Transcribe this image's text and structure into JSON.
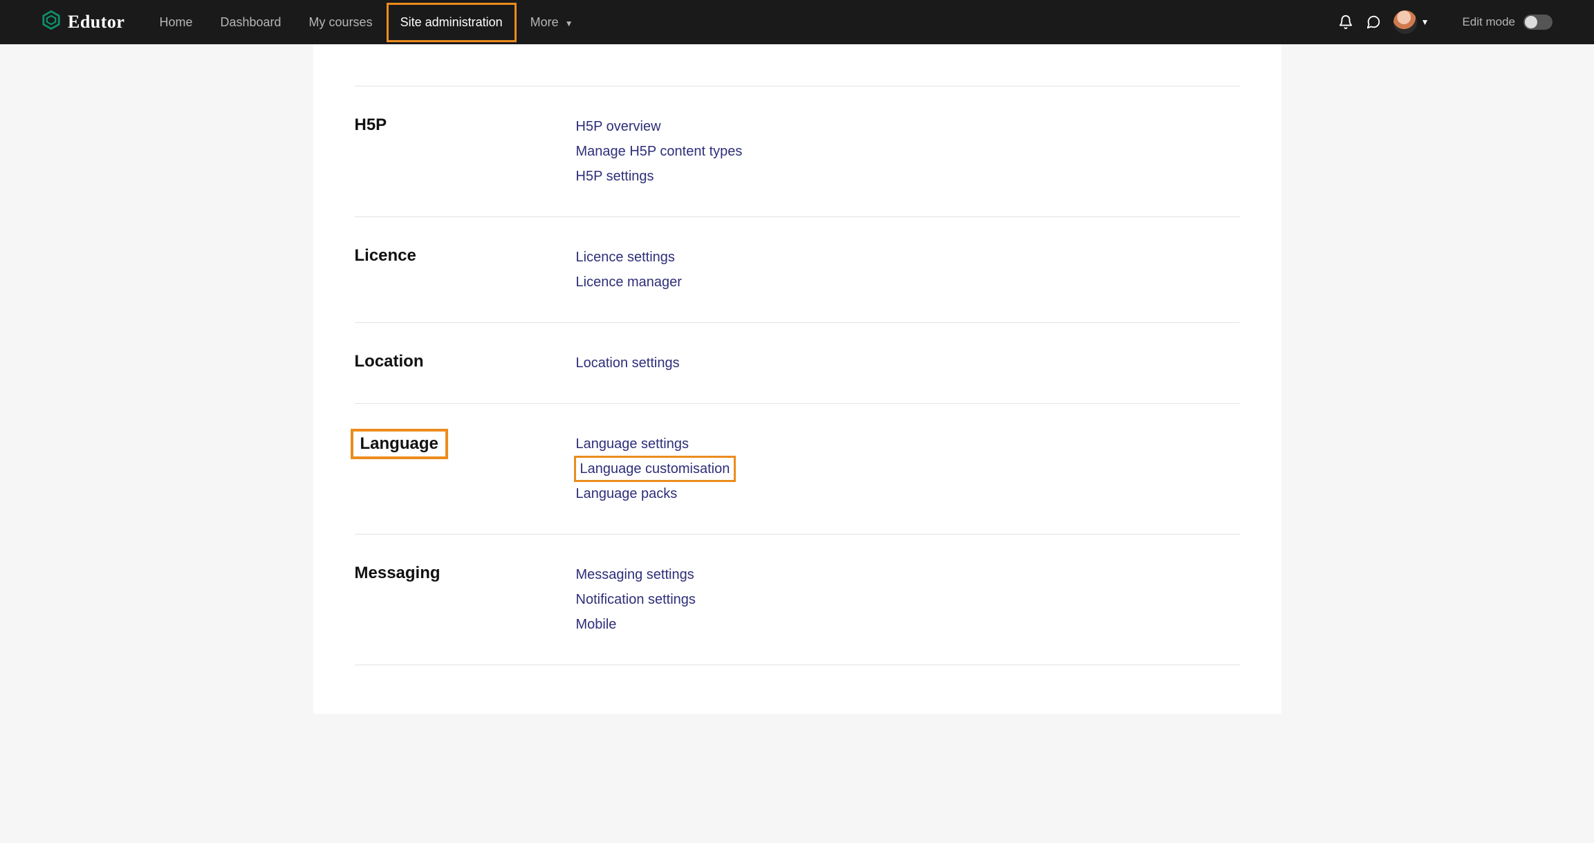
{
  "brand": {
    "name": "Edutor"
  },
  "nav": {
    "home": "Home",
    "dashboard": "Dashboard",
    "my_courses": "My courses",
    "site_admin": "Site administration",
    "more": "More"
  },
  "edit_mode_label": "Edit mode",
  "sections": {
    "h5p": {
      "title": "H5P",
      "links": {
        "overview": "H5P overview",
        "manage": "Manage H5P content types",
        "settings": "H5P settings"
      }
    },
    "licence": {
      "title": "Licence",
      "links": {
        "settings": "Licence settings",
        "manager": "Licence manager"
      }
    },
    "location": {
      "title": "Location",
      "links": {
        "settings": "Location settings"
      }
    },
    "language": {
      "title": "Language",
      "links": {
        "settings": "Language settings",
        "customisation": "Language customisation",
        "packs": "Language packs"
      }
    },
    "messaging": {
      "title": "Messaging",
      "links": {
        "settings": "Messaging settings",
        "notification": "Notification settings",
        "mobile": "Mobile"
      }
    }
  }
}
